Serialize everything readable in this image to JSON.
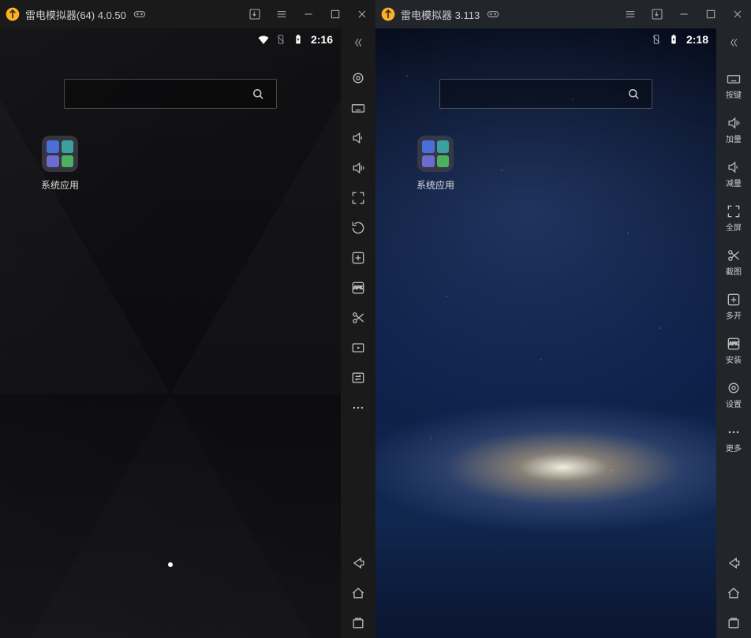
{
  "left": {
    "titlebar": {
      "title": "雷电模拟器(64) 4.0.50"
    },
    "statusbar": {
      "time": "2:16"
    },
    "folder": {
      "label": "系统应用"
    },
    "sidebar": {
      "items": [
        {
          "name": "settings",
          "label": ""
        },
        {
          "name": "keyboard",
          "label": ""
        },
        {
          "name": "volume-down",
          "label": ""
        },
        {
          "name": "volume-up",
          "label": ""
        },
        {
          "name": "fullscreen",
          "label": ""
        },
        {
          "name": "restart",
          "label": ""
        },
        {
          "name": "add-instance",
          "label": ""
        },
        {
          "name": "install-apk",
          "label": ""
        },
        {
          "name": "screenshot",
          "label": ""
        },
        {
          "name": "record",
          "label": ""
        },
        {
          "name": "transfer",
          "label": ""
        },
        {
          "name": "more",
          "label": ""
        }
      ],
      "bottom": [
        {
          "name": "back",
          "label": ""
        },
        {
          "name": "home",
          "label": ""
        },
        {
          "name": "recents",
          "label": ""
        }
      ]
    }
  },
  "right": {
    "titlebar": {
      "title": "雷电模拟器 3.113"
    },
    "statusbar": {
      "time": "2:18"
    },
    "folder": {
      "label": "系统应用"
    },
    "sidebar": {
      "items": [
        {
          "name": "keyboard",
          "label": "按键"
        },
        {
          "name": "volume-up",
          "label": "加量"
        },
        {
          "name": "volume-down",
          "label": "减量"
        },
        {
          "name": "fullscreen",
          "label": "全屏"
        },
        {
          "name": "screenshot",
          "label": "截图"
        },
        {
          "name": "multi-instance",
          "label": "多开"
        },
        {
          "name": "install-apk",
          "label": "安装"
        },
        {
          "name": "settings",
          "label": "设置"
        },
        {
          "name": "more",
          "label": "更多"
        }
      ],
      "bottom": [
        {
          "name": "back",
          "label": ""
        },
        {
          "name": "home",
          "label": ""
        },
        {
          "name": "recents",
          "label": ""
        }
      ]
    }
  }
}
